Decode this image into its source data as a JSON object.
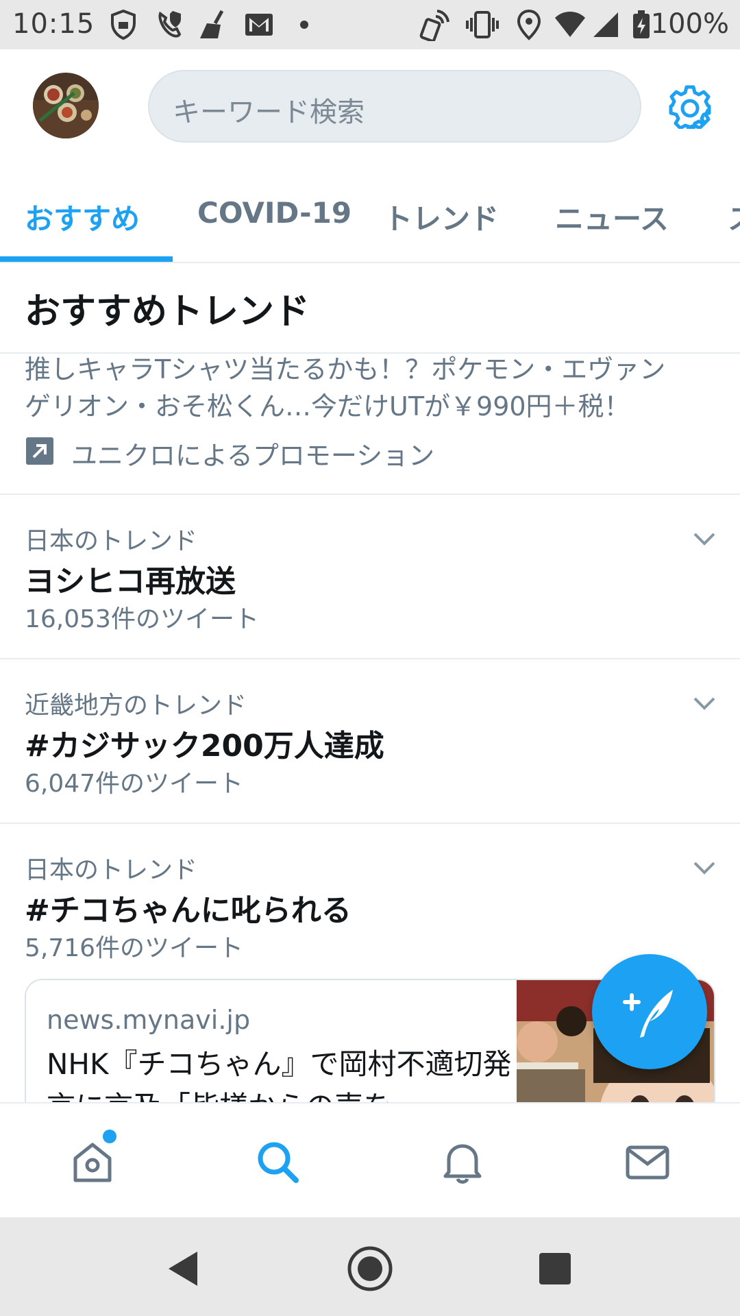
{
  "status_bar": {
    "time": "10:15",
    "battery": "100%",
    "icons": [
      "shield-icon",
      "phone-shield-icon",
      "broom-icon",
      "gmail-icon",
      "dot-icon",
      "nfc-icon",
      "vibrate-icon",
      "location-icon",
      "wifi-icon",
      "signal-icon",
      "battery-charging-icon"
    ]
  },
  "header": {
    "avatar_icon": "avatar",
    "search_placeholder": "キーワード検索",
    "settings_icon": "gear-icon"
  },
  "tabs": [
    {
      "label": "おすすめ",
      "active": true
    },
    {
      "label": "COVID-19",
      "active": false
    },
    {
      "label": "トレンド",
      "active": false
    },
    {
      "label": "ニュース",
      "active": false
    },
    {
      "label": "ス",
      "active": false
    }
  ],
  "section_title": "おすすめトレンド",
  "promoted": {
    "line1": "推しキャラTシャツ当たるかも！？ポケモン・エヴァン",
    "line2": "ゲリオン・おそ松くん…今だけUTが￥990円＋税！",
    "by": "ユニクロによるプロモーション",
    "icon": "promoted-arrow-icon"
  },
  "trends": [
    {
      "context": "日本のトレンド",
      "name": "ヨシヒコ再放送",
      "count": "16,053件のツイート"
    },
    {
      "context": "近畿地方のトレンド",
      "name": "#カジサック200万人達成",
      "count": "6,047件のツイート"
    },
    {
      "context": "日本のトレンド",
      "name": "#チコちゃんに叱られる",
      "count": "5,716件のツイート"
    }
  ],
  "news_card": {
    "source": "news.mynavi.jp",
    "headline": "NHK『チコちゃん』で岡村不適切発言に言及「皆様からの声を"
  },
  "fab_icon": "compose-tweet-icon",
  "bottom_nav": [
    "home-icon",
    "search-icon",
    "bell-icon",
    "mail-icon"
  ],
  "system_nav": [
    "back-icon",
    "home-circle-icon",
    "recents-icon"
  ],
  "colors": {
    "accent": "#1da1f2",
    "secondary_text": "#657786",
    "primary_text": "#14171a",
    "divider": "#e6ecf0"
  }
}
